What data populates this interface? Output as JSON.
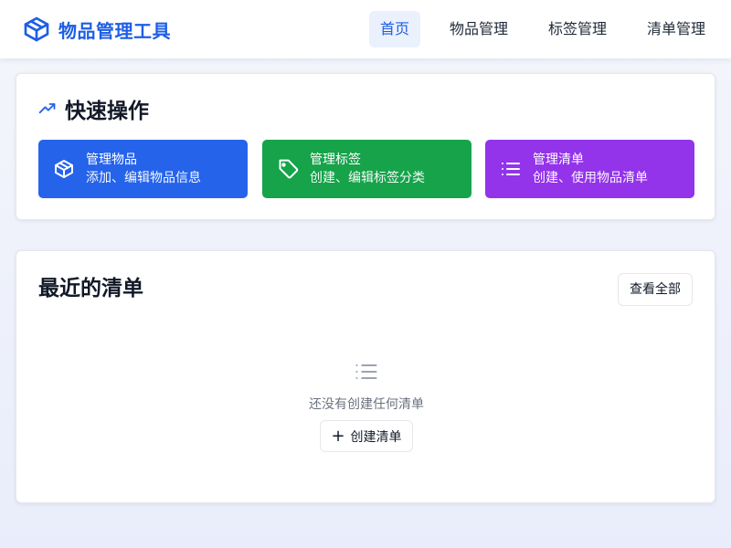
{
  "header": {
    "app_title": "物品管理工具",
    "brand_icon": "package-icon",
    "nav": [
      {
        "label": "首页",
        "active": true
      },
      {
        "label": "物品管理",
        "active": false
      },
      {
        "label": "标签管理",
        "active": false
      },
      {
        "label": "清单管理",
        "active": false
      }
    ]
  },
  "quick_actions": {
    "title": "快速操作",
    "icon": "trending-up-icon",
    "items": [
      {
        "title": "管理物品",
        "desc": "添加、编辑物品信息",
        "icon": "package-icon",
        "color": "#2563eb"
      },
      {
        "title": "管理标签",
        "desc": "创建、编辑标签分类",
        "icon": "tag-icon",
        "color": "#16a34a"
      },
      {
        "title": "管理清单",
        "desc": "创建、使用物品清单",
        "icon": "list-icon",
        "color": "#9333ea"
      }
    ]
  },
  "recent_lists": {
    "title": "最近的清单",
    "view_all_label": "查看全部",
    "empty_icon": "list-icon",
    "empty_text": "还没有创建任何清单",
    "create_label": "创建清单",
    "create_icon": "plus-icon"
  },
  "colors": {
    "brand": "#1d5ee5",
    "nav_active_bg": "#eaf1fd"
  }
}
